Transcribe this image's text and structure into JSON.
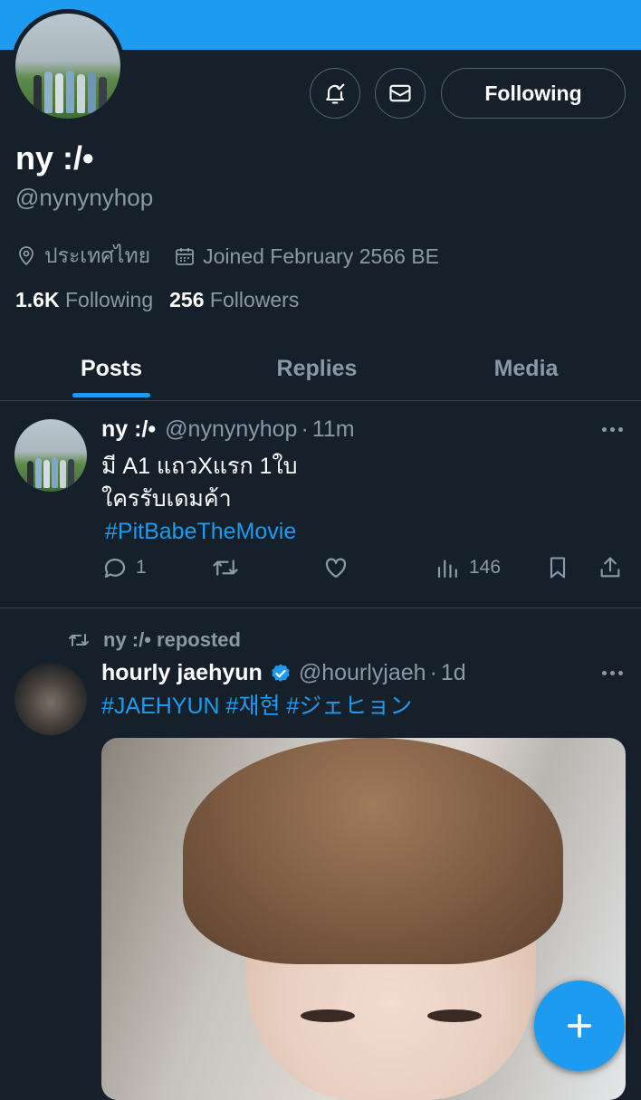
{
  "colors": {
    "accent": "#1d9bf0",
    "background": "#15202b",
    "secondary_text": "#8b98a5",
    "border": "#38444d"
  },
  "profile": {
    "name": "ny :/•",
    "handle": "@nynynyhop",
    "location": "ประเทศไทย",
    "joined": "Joined February 2566 BE",
    "following_count": "1.6K",
    "following_label": "Following",
    "followers_count": "256",
    "followers_label": "Followers",
    "following_button_label": "Following",
    "icons": {
      "notify": "bell-check-icon",
      "message": "envelope-icon"
    }
  },
  "tabs": [
    {
      "label": "Posts",
      "active": true
    },
    {
      "label": "Replies",
      "active": false
    },
    {
      "label": "Media",
      "active": false
    }
  ],
  "posts": [
    {
      "author_name": "ny :/•",
      "author_handle": "@nynynyhop",
      "time": "11m",
      "text_line1": "มี A1 แถวXแรก 1ใบ",
      "text_line2": "ใครรับเดมค้า",
      "hashtag": "#PitBabeTheMovie",
      "reply_count": "1",
      "repost_count": "",
      "like_count": "",
      "view_count": "146"
    },
    {
      "repost_label": "ny :/• reposted",
      "author_name": "hourly jaehyun",
      "author_handle": "@hourlyjaeh",
      "time": "1d",
      "verified": true,
      "hashtags": "#JAEHYUN #재현 #ジェヒョン"
    }
  ],
  "fab": {
    "icon": "plus-icon"
  }
}
